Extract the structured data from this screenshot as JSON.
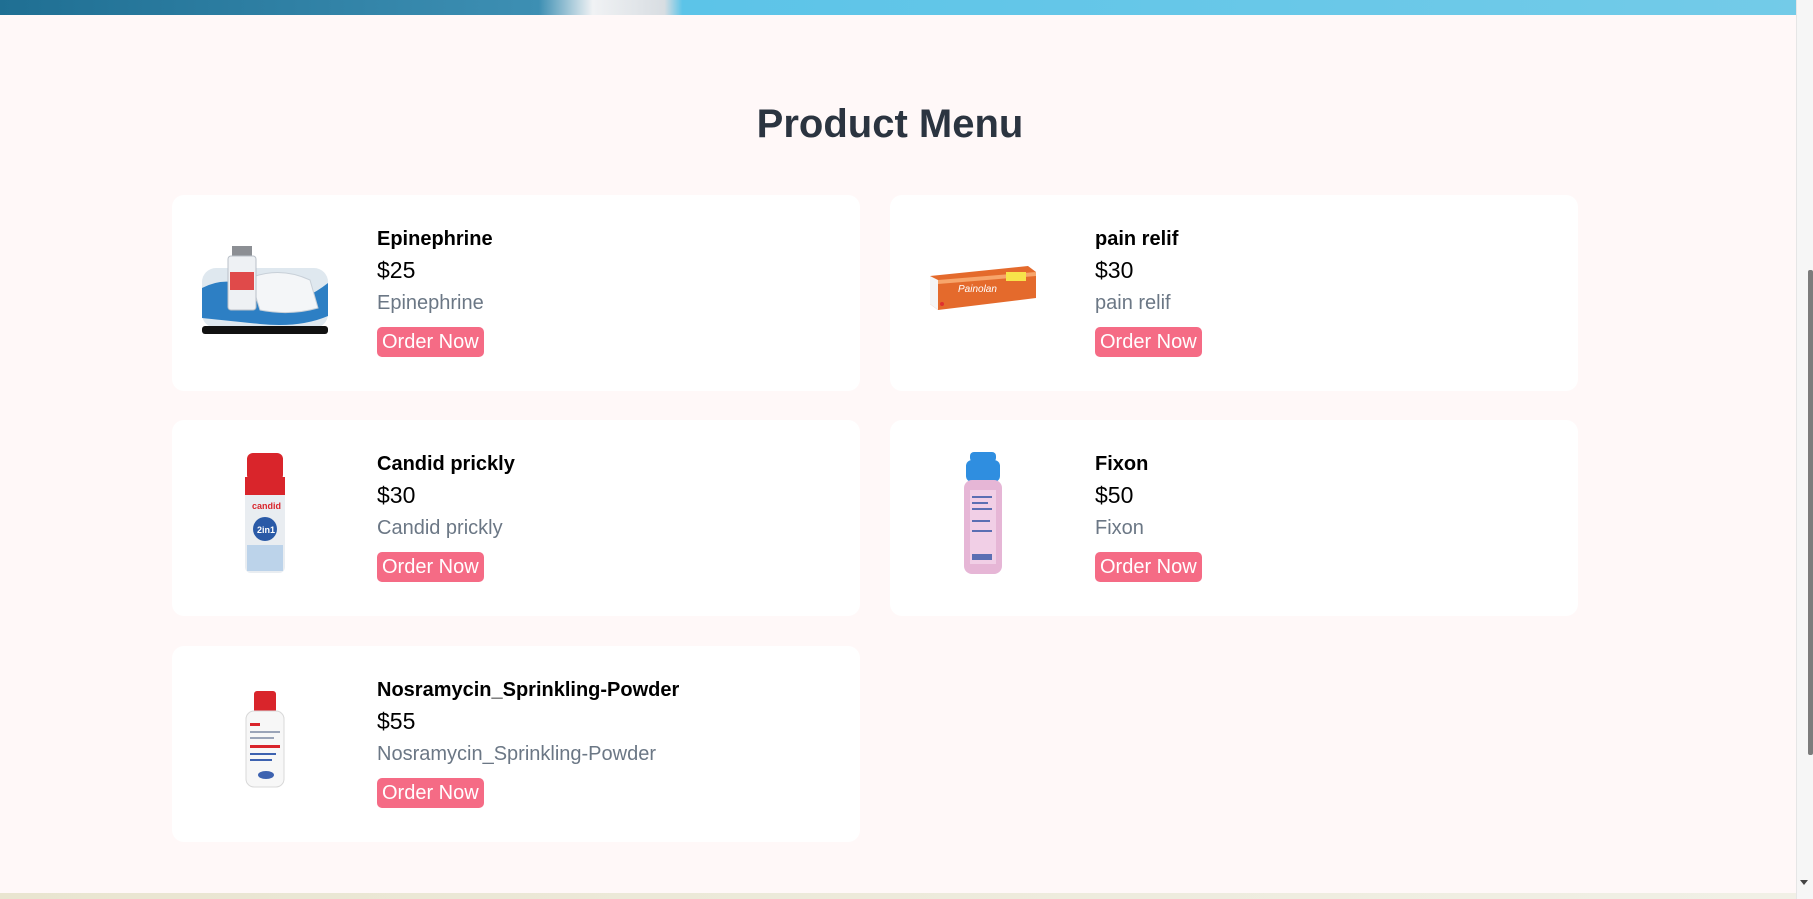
{
  "page": {
    "title": "Product Menu"
  },
  "products": [
    {
      "name": "Epinephrine",
      "price": "$25",
      "description": "Epinephrine",
      "order_label": "Order Now",
      "image": "vial-with-masks-image"
    },
    {
      "name": "pain relif",
      "price": "$30",
      "description": "pain relif",
      "order_label": "Order Now",
      "image": "orange-tube-box-image"
    },
    {
      "name": "Candid prickly",
      "price": "$30",
      "description": "Candid prickly",
      "order_label": "Order Now",
      "image": "red-powder-bottle-image"
    },
    {
      "name": "Fixon",
      "price": "$50",
      "description": "Fixon",
      "order_label": "Order Now",
      "image": "pink-lotion-bottle-image"
    },
    {
      "name": "Nosramycin_Sprinkling-Powder",
      "price": "$55",
      "description": "Nosramycin_Sprinkling-Powder",
      "order_label": "Order Now",
      "image": "white-powder-bottle-image"
    }
  ],
  "colors": {
    "background": "#fff8f8",
    "card": "#ffffff",
    "button": "#f56b85",
    "title": "#2b3440",
    "muted_text": "#6b7785"
  }
}
